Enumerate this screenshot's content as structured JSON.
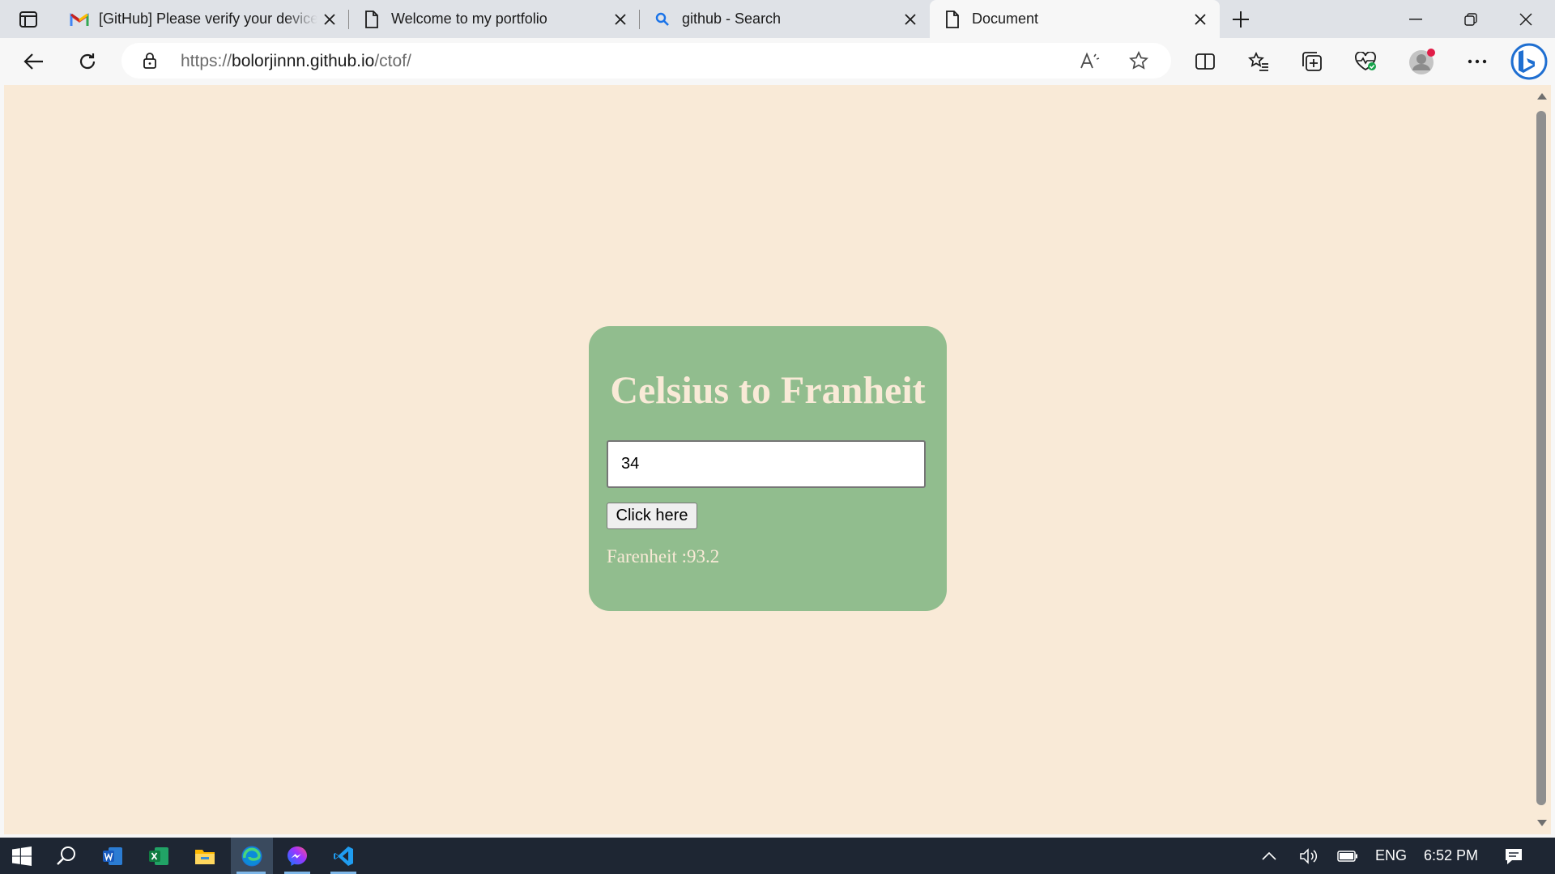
{
  "browser": {
    "tabs": [
      {
        "title": "[GitHub] Please verify your device",
        "icon": "gmail-icon"
      },
      {
        "title": "Welcome to my portfolio",
        "icon": "page-icon"
      },
      {
        "title": "github - Search",
        "icon": "search-icon"
      },
      {
        "title": "Document",
        "icon": "page-icon"
      }
    ],
    "active_tab_index": 3,
    "address": {
      "scheme": "https://",
      "host": "bolorjinnn.github.io",
      "path": "/ctof/"
    }
  },
  "page": {
    "background_color": "#f9ead7",
    "card_color": "#91bd8e",
    "title": "Celsius to Franheit",
    "input_value": "34",
    "button_label": "Click here",
    "result_text": "Farenheit :93.2"
  },
  "taskbar": {
    "apps": [
      "windows-start-icon",
      "search-icon",
      "word-icon",
      "excel-icon",
      "file-explorer-icon",
      "edge-icon",
      "messenger-icon",
      "vscode-icon"
    ],
    "language": "ENG",
    "time": "6:52 PM"
  },
  "colors": {
    "accent": "#7fb7e8",
    "taskbar": "#1e2633"
  }
}
